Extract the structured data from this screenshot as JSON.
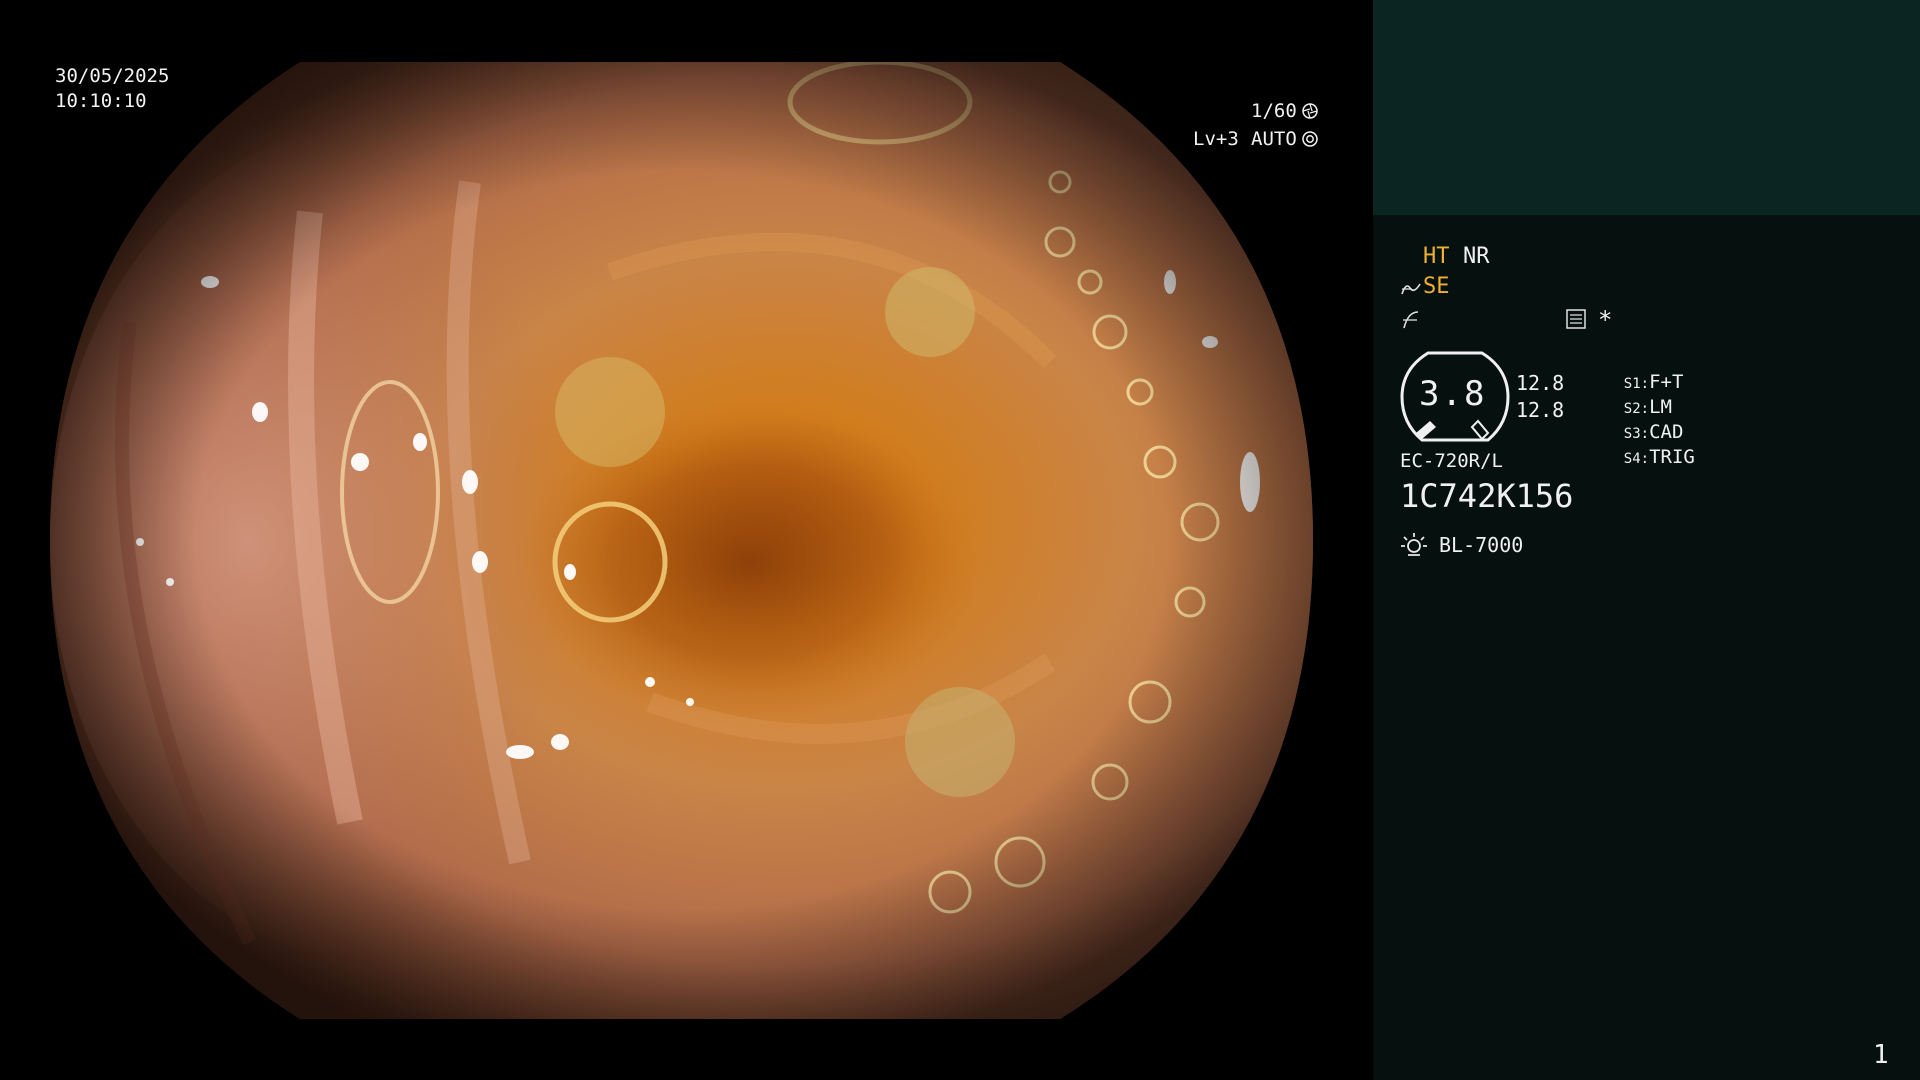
{
  "overlay": {
    "date": "30/05/2025",
    "time": "10:10:10",
    "shutter": "1/60",
    "shutter_icon": "aperture-icon",
    "level": "Lv+3",
    "iris_mode": "AUTO",
    "iris_icon": "iris-icon"
  },
  "panel": {
    "ht": "HT",
    "nr": "NR",
    "se": "SE",
    "se_icon": "enhance-curve-icon",
    "gamma_icon": "gamma-curve-icon",
    "memory_icon": "memory-icon",
    "asterisk": "*",
    "gauge_value": "3.8",
    "gauge_icon": "endoscope-gauge-icon",
    "val_top": "12.8",
    "val_bottom": "12.8",
    "switches": [
      {
        "key": "S1",
        "value": "F+T"
      },
      {
        "key": "S2",
        "value": "LM"
      },
      {
        "key": "S3",
        "value": "CAD"
      },
      {
        "key": "S4",
        "value": "TRIG"
      }
    ],
    "scope_model": "EC-720R/L",
    "serial": "1C742K156",
    "light_icon": "light-source-icon",
    "light_source": "BL-7000",
    "page_number": "1"
  },
  "colors": {
    "panel_bg": "#06110f",
    "panel_top_bg": "#0b2522",
    "accent_amber": "#f0b030",
    "text": "#f0f0f0"
  }
}
